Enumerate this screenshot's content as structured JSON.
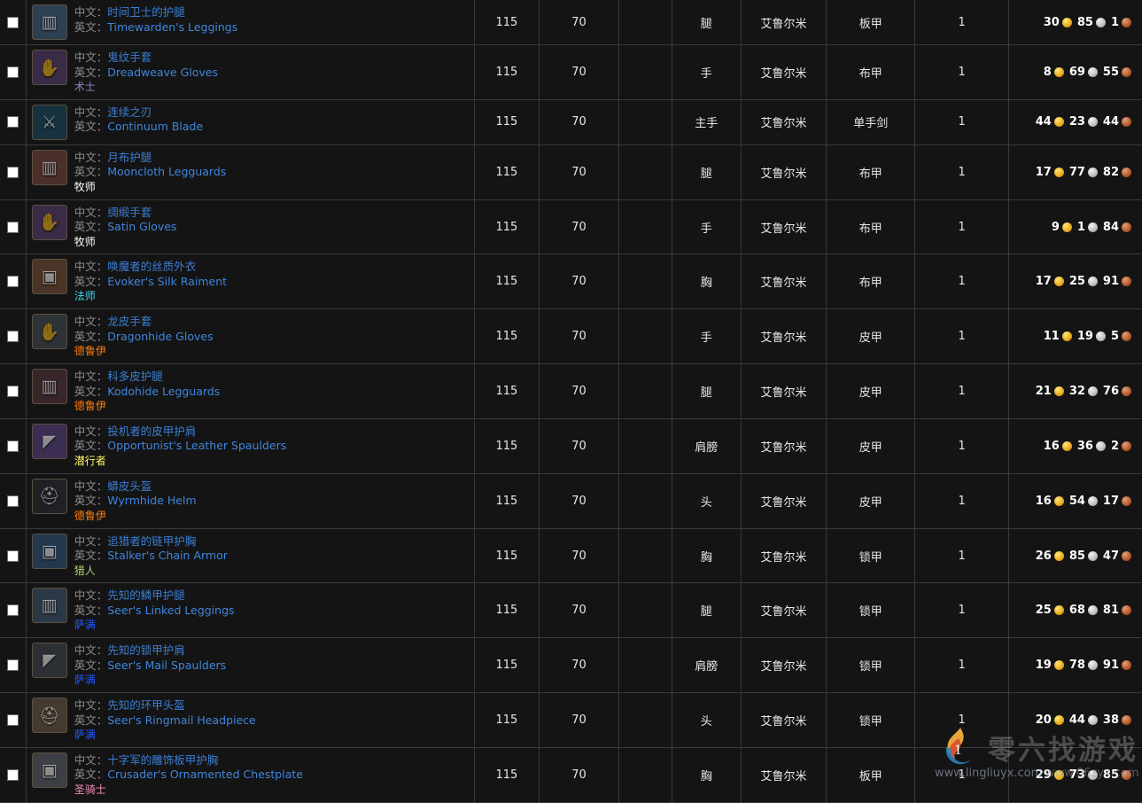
{
  "table": {
    "labels": {
      "cn": "中文：",
      "en": "英文："
    },
    "rows": [
      {
        "checked": false,
        "icon": "leggings-icon",
        "icon_glyph": "▥",
        "icon_bg": "#2d3f52",
        "name_cn": "时间卫士的护腿",
        "name_en": "Timewarden's Leggings",
        "class": "",
        "class_color": "",
        "ilvl": "115",
        "req_level": "70",
        "blank": "",
        "slot": "腿",
        "source": "艾鲁尔米",
        "armor": "板甲",
        "qty": "1",
        "gold": "30",
        "silver": "85",
        "copper": "1"
      },
      {
        "checked": false,
        "icon": "gloves-icon",
        "icon_glyph": "✋",
        "icon_bg": "#3a2b46",
        "name_cn": "鬼纹手套",
        "name_en": "Dreadweave Gloves",
        "class": "术士",
        "class_color": "#9482c9",
        "ilvl": "115",
        "req_level": "70",
        "blank": "",
        "slot": "手",
        "source": "艾鲁尔米",
        "armor": "布甲",
        "qty": "1",
        "gold": "8",
        "silver": "69",
        "copper": "55"
      },
      {
        "checked": false,
        "icon": "sword-icon",
        "icon_glyph": "⚔",
        "icon_bg": "#17323f",
        "name_cn": "连续之刃",
        "name_en": "Continuum Blade",
        "class": "",
        "class_color": "",
        "ilvl": "115",
        "req_level": "70",
        "blank": "",
        "slot": "主手",
        "source": "艾鲁尔米",
        "armor": "单手剑",
        "qty": "1",
        "gold": "44",
        "silver": "23",
        "copper": "44"
      },
      {
        "checked": false,
        "icon": "leggings-icon",
        "icon_glyph": "▥",
        "icon_bg": "#4a2f2a",
        "name_cn": "月布护腿",
        "name_en": "Mooncloth Legguards",
        "class": "牧师",
        "class_color": "#ffffff",
        "ilvl": "115",
        "req_level": "70",
        "blank": "",
        "slot": "腿",
        "source": "艾鲁尔米",
        "armor": "布甲",
        "qty": "1",
        "gold": "17",
        "silver": "77",
        "copper": "82"
      },
      {
        "checked": false,
        "icon": "gloves-icon",
        "icon_glyph": "✋",
        "icon_bg": "#3a2b46",
        "name_cn": "绸缎手套",
        "name_en": "Satin Gloves",
        "class": "牧师",
        "class_color": "#ffffff",
        "ilvl": "115",
        "req_level": "70",
        "blank": "",
        "slot": "手",
        "source": "艾鲁尔米",
        "armor": "布甲",
        "qty": "1",
        "gold": "9",
        "silver": "1",
        "copper": "84"
      },
      {
        "checked": false,
        "icon": "chest-icon",
        "icon_glyph": "▣",
        "icon_bg": "#4a3526",
        "name_cn": "唤魔者的丝质外衣",
        "name_en": "Evoker's Silk Raiment",
        "class": "法师",
        "class_color": "#44d3f2",
        "ilvl": "115",
        "req_level": "70",
        "blank": "",
        "slot": "胸",
        "source": "艾鲁尔米",
        "armor": "布甲",
        "qty": "1",
        "gold": "17",
        "silver": "25",
        "copper": "91"
      },
      {
        "checked": false,
        "icon": "gloves-icon",
        "icon_glyph": "✋",
        "icon_bg": "#2e3338",
        "name_cn": "龙皮手套",
        "name_en": "Dragonhide Gloves",
        "class": "德鲁伊",
        "class_color": "#ff7d0a",
        "ilvl": "115",
        "req_level": "70",
        "blank": "",
        "slot": "手",
        "source": "艾鲁尔米",
        "armor": "皮甲",
        "qty": "1",
        "gold": "11",
        "silver": "19",
        "copper": "5"
      },
      {
        "checked": false,
        "icon": "leggings-icon",
        "icon_glyph": "▥",
        "icon_bg": "#39262a",
        "name_cn": "科多皮护腿",
        "name_en": "Kodohide Legguards",
        "class": "德鲁伊",
        "class_color": "#ff7d0a",
        "ilvl": "115",
        "req_level": "70",
        "blank": "",
        "slot": "腿",
        "source": "艾鲁尔米",
        "armor": "皮甲",
        "qty": "1",
        "gold": "21",
        "silver": "32",
        "copper": "76"
      },
      {
        "checked": false,
        "icon": "spaulders-icon",
        "icon_glyph": "◤",
        "icon_bg": "#3b2e52",
        "name_cn": "投机者的皮甲护肩",
        "name_en": "Opportunist's Leather Spaulders",
        "class": "潜行者",
        "class_color": "#fff569",
        "ilvl": "115",
        "req_level": "70",
        "blank": "",
        "slot": "肩膀",
        "source": "艾鲁尔米",
        "armor": "皮甲",
        "qty": "1",
        "gold": "16",
        "silver": "36",
        "copper": "2"
      },
      {
        "checked": false,
        "icon": "helm-icon",
        "icon_glyph": "⛑",
        "icon_bg": "#1f2125",
        "name_cn": "蟒皮头盔",
        "name_en": "Wyrmhide Helm",
        "class": "德鲁伊",
        "class_color": "#ff7d0a",
        "ilvl": "115",
        "req_level": "70",
        "blank": "",
        "slot": "头",
        "source": "艾鲁尔米",
        "armor": "皮甲",
        "qty": "1",
        "gold": "16",
        "silver": "54",
        "copper": "17"
      },
      {
        "checked": false,
        "icon": "chest-icon",
        "icon_glyph": "▣",
        "icon_bg": "#23384f",
        "name_cn": "追猎者的链甲护胸",
        "name_en": "Stalker's Chain Armor",
        "class": "猎人",
        "class_color": "#a9d271",
        "ilvl": "115",
        "req_level": "70",
        "blank": "",
        "slot": "胸",
        "source": "艾鲁尔米",
        "armor": "锁甲",
        "qty": "1",
        "gold": "26",
        "silver": "85",
        "copper": "47"
      },
      {
        "checked": false,
        "icon": "leggings-icon",
        "icon_glyph": "▥",
        "icon_bg": "#2b3946",
        "name_cn": "先知的鳞甲护腿",
        "name_en": "Seer's Linked Leggings",
        "class": "萨满",
        "class_color": "#2459ff",
        "ilvl": "115",
        "req_level": "70",
        "blank": "",
        "slot": "腿",
        "source": "艾鲁尔米",
        "armor": "锁甲",
        "qty": "1",
        "gold": "25",
        "silver": "68",
        "copper": "81"
      },
      {
        "checked": false,
        "icon": "spaulders-icon",
        "icon_glyph": "◤",
        "icon_bg": "#2c2f33",
        "name_cn": "先知的锁甲护肩",
        "name_en": "Seer's Mail Spaulders",
        "class": "萨满",
        "class_color": "#2459ff",
        "ilvl": "115",
        "req_level": "70",
        "blank": "",
        "slot": "肩膀",
        "source": "艾鲁尔米",
        "armor": "锁甲",
        "qty": "1",
        "gold": "19",
        "silver": "78",
        "copper": "91"
      },
      {
        "checked": false,
        "icon": "helm-icon",
        "icon_glyph": "⛑",
        "icon_bg": "#453a30",
        "name_cn": "先知的环甲头盔",
        "name_en": "Seer's Ringmail Headpiece",
        "class": "萨满",
        "class_color": "#2459ff",
        "ilvl": "115",
        "req_level": "70",
        "blank": "",
        "slot": "头",
        "source": "艾鲁尔米",
        "armor": "锁甲",
        "qty": "1",
        "gold": "20",
        "silver": "44",
        "copper": "38"
      },
      {
        "checked": false,
        "icon": "chest-icon",
        "icon_glyph": "▣",
        "icon_bg": "#3c3f44",
        "name_cn": "十字军的雕饰板甲护胸",
        "name_en": "Crusader's Ornamented Chestplate",
        "class": "圣骑士",
        "class_color": "#f58cba",
        "ilvl": "115",
        "req_level": "70",
        "blank": "",
        "slot": "胸",
        "source": "艾鲁尔米",
        "armor": "板甲",
        "qty": "1",
        "gold": "29",
        "silver": "73",
        "copper": "85"
      }
    ]
  },
  "watermark": {
    "brand": "零六找游戏",
    "url1": "www.lingliuyx.com",
    "url2": "www.06zyx.com"
  }
}
